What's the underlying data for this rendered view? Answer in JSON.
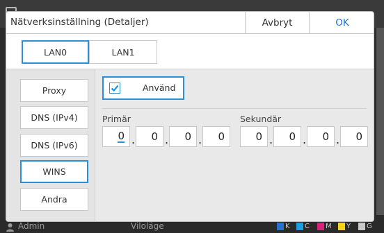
{
  "dialog": {
    "title": "Nätverksinställning (Detaljer)",
    "cancel_label": "Avbryt",
    "ok_label": "OK"
  },
  "lan_tabs": [
    {
      "label": "LAN0",
      "active": true
    },
    {
      "label": "LAN1",
      "active": false
    }
  ],
  "nav": {
    "items": [
      {
        "label": "Proxy",
        "active": false
      },
      {
        "label": "DNS (IPv4)",
        "active": false
      },
      {
        "label": "DNS (IPv6)",
        "active": false
      },
      {
        "label": "WINS",
        "active": true
      },
      {
        "label": "Andra",
        "active": false
      }
    ]
  },
  "wins": {
    "use_label": "Använd",
    "use_checked": true,
    "primary_label": "Primär",
    "primary_octets": [
      "0",
      "0",
      "0",
      "0"
    ],
    "secondary_label": "Sekundär",
    "secondary_octets": [
      "0",
      "0",
      "0",
      "0"
    ]
  },
  "statusbar": {
    "user": "Admin",
    "mode": "Viloläge",
    "inks": [
      "K",
      "C",
      "M",
      "Y",
      "G"
    ]
  },
  "colors": {
    "accent": "#2b8fd6",
    "ok_text": "#1f6fd1",
    "ink_K": "#1a1a1a",
    "ink_C": "#1aa0e0",
    "ink_M": "#d6237a",
    "ink_Y": "#f2d21a",
    "ink_G": "#c8c8c8"
  }
}
